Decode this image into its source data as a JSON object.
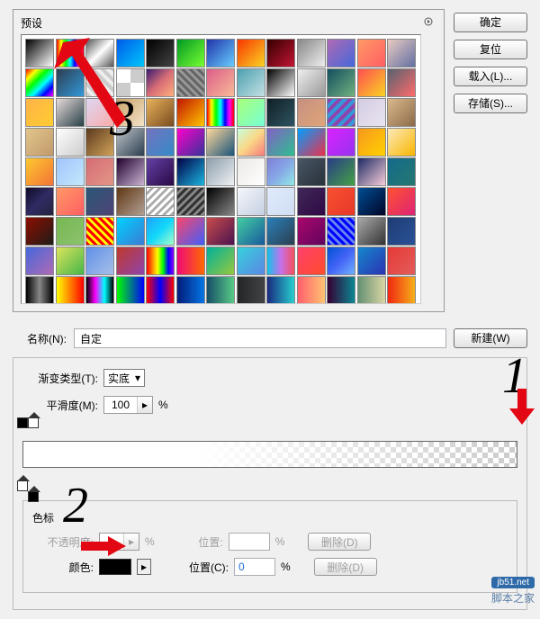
{
  "annotations": {
    "one": "1",
    "two": "2",
    "three": "3"
  },
  "presets": {
    "title": "预设"
  },
  "buttons": {
    "ok": "确定",
    "reset": "复位",
    "load": "载入(L)...",
    "save": "存储(S)...",
    "new": "新建(W)"
  },
  "name_row": {
    "label": "名称(N):",
    "value": "自定"
  },
  "gradient": {
    "type_label": "渐变类型(T):",
    "type_value": "实底",
    "smooth_label": "平滑度(M):",
    "smooth_value": "100",
    "percent": "%"
  },
  "stops": {
    "title": "色标",
    "opacity_label": "不透明度:",
    "position_label": "位置:",
    "percent": "%",
    "delete": "删除(D)",
    "color_label": "颜色:",
    "position2_label": "位置(C):",
    "position2_value": "0"
  },
  "watermark": {
    "badge": "jb51.net",
    "text": "脚本之家"
  },
  "swatches": [
    "linear-gradient(135deg,#000,#fff)",
    "linear-gradient(90deg,#f00,#ff0,#0f0,#0ff,#00f,#f0f,#f00)",
    "linear-gradient(135deg,#555,#fff,#555)",
    "linear-gradient(135deg,#005bea,#00c6fb)",
    "linear-gradient(135deg,#000,#434343)",
    "linear-gradient(135deg,#092,#7f3)",
    "linear-gradient(135deg,#23a,#6cf)",
    "linear-gradient(135deg,#f83600,#f9d423)",
    "linear-gradient(135deg,#300,#c31432)",
    "linear-gradient(135deg,#888,#eee)",
    "linear-gradient(135deg,#b06ab3,#4568dc)",
    "linear-gradient(135deg,#ff9966,#ff5e62)",
    "linear-gradient(135deg,#e8cbc0,#636fa4)",
    "linear-gradient(135deg,#f00,#ff0,#0f0,#0ff,#00f,#f0f)",
    "linear-gradient(135deg,#2c3e50,#3498db)",
    "repeating-linear-gradient(45deg,#ccc 0 4px,#eee 4px 8px)",
    "repeating-conic-gradient(#ccc 0 25%,#fff 0 50%)",
    "linear-gradient(135deg,#3a1c71,#d76d77,#ffaf7b)",
    "repeating-linear-gradient(45deg,#666 0 3px,#999 3px 6px)",
    "linear-gradient(135deg,#dd5e89,#f7bb97)",
    "linear-gradient(135deg,#4ca1af,#c4e0e5)",
    "linear-gradient(135deg,#000,#fff)",
    "linear-gradient(135deg,#eee,#999)",
    "linear-gradient(135deg,#134e5e,#71b280)",
    "linear-gradient(135deg,#ff4e50,#f9d423)",
    "linear-gradient(135deg,#556270,#ff6b6b)",
    "linear-gradient(135deg,#ffb347,#ffcc33)",
    "linear-gradient(135deg,#e6dada,#274046)",
    "linear-gradient(135deg,#ddd6f3,#faaca8)",
    "linear-gradient(135deg,#c9a36a,#f3e2c7)",
    "linear-gradient(135deg,#e8b25b,#7a4b1f)",
    "linear-gradient(135deg,#c21500,#ffc500)",
    "linear-gradient(90deg,#f00,#ff0,#0f0,#0ff,#00f,#f0f,#f00)",
    "linear-gradient(135deg,#a8ff78,#78ffd6)",
    "linear-gradient(135deg,#0f2027,#203a43,#2c5364)",
    "linear-gradient(135deg,#c79081,#dfa579)",
    "repeating-linear-gradient(135deg,#8e44ad 0 4px,#3498db 4px 8px)",
    "linear-gradient(135deg,#d3cce3,#e9e4f0)",
    "linear-gradient(135deg,#dab88b,#8b6b4a)",
    "linear-gradient(135deg,#e2c58b,#c19a6b)",
    "linear-gradient(135deg,#fff,#ccc)",
    "linear-gradient(135deg,#5b3a1e,#d2a35a)",
    "linear-gradient(135deg,#bdc3c7,#2c3e50)",
    "linear-gradient(135deg,#7474bf,#348ac7)",
    "linear-gradient(135deg,#ff00cc,#333399)",
    "linear-gradient(135deg,#ffd89b,#19547b)",
    "linear-gradient(135deg,#c6ffdd,#fbd786,#f7797d)",
    "linear-gradient(135deg,#8360c3,#2ebf91)",
    "linear-gradient(135deg,#009fff,#ec2f4b)",
    "linear-gradient(135deg,#da22ff,#9733ee)",
    "linear-gradient(135deg,#f7971e,#ffd200)",
    "linear-gradient(135deg,#fceabb,#f8b500)",
    "linear-gradient(135deg,#fdc830,#f37335)",
    "linear-gradient(135deg,#a1c4fd,#c2e9fb)",
    "linear-gradient(135deg,#d66d75,#e29587)",
    "linear-gradient(135deg,#20002c,#cbb4d4)",
    "linear-gradient(135deg,#6441a5,#2a0845)",
    "linear-gradient(135deg,#000046,#1cb5e0)",
    "linear-gradient(135deg,#8e9eab,#eef2f3)",
    "linear-gradient(135deg,#ece9e6,#fff)",
    "linear-gradient(135deg,#7f7fd5,#86a8e7,#91eae4)",
    "linear-gradient(135deg,#485563,#29323c)",
    "linear-gradient(135deg,#283c86,#45a247)",
    "linear-gradient(135deg,#1d2b64,#f8cdda)",
    "linear-gradient(135deg,#136a8a,#267871)",
    "linear-gradient(135deg,#0f0c29,#302b63,#24243e)",
    "linear-gradient(135deg,#ff9966,#ff5e62)",
    "linear-gradient(135deg,#2b5876,#4e4376)",
    "linear-gradient(135deg,#603813,#b29f94)",
    "repeating-linear-gradient(135deg,#fff 0 3px,#aaa 3px 6px)",
    "repeating-linear-gradient(135deg,#333 0 3px,#888 3px 6px)",
    "linear-gradient(135deg,#000,#888)",
    "linear-gradient(135deg,#f5f7fa,#c3cfe2)",
    "linear-gradient(135deg,#e0eafc,#cfdef3)",
    "linear-gradient(135deg,#41295a,#2f0743)",
    "linear-gradient(135deg,#f85032,#e73827)",
    "linear-gradient(135deg,#004e92,#000428)",
    "linear-gradient(135deg,#ff512f,#dd2476)",
    "linear-gradient(135deg,#8e0e00,#1f1c18)",
    "linear-gradient(135deg,#76b852,#8dc26f)",
    "repeating-linear-gradient(45deg,#f00 0 3px,#ff0 3px 6px)",
    "linear-gradient(135deg,#00d2ff,#3a7bd5)",
    "linear-gradient(135deg,#1fa2ff,#12d8fa,#a6ffcb)",
    "linear-gradient(135deg,#fc466b,#3f5efb)",
    "linear-gradient(135deg,#c94b4b,#4b134f)",
    "linear-gradient(135deg,#43cea2,#185a9d)",
    "linear-gradient(135deg,#2980b9,#2c3e50)",
    "linear-gradient(135deg,#aa076b,#61045f)",
    "repeating-linear-gradient(45deg,#00f 0 3px,#68e 3px 6px)",
    "linear-gradient(135deg,#aaa,#333)",
    "linear-gradient(135deg,#1e3c72,#2a5298)",
    "linear-gradient(135deg,#4568dc,#b06ab3)",
    "linear-gradient(135deg,#dce35b,#45b649)",
    "linear-gradient(135deg,#6190e8,#a7bfe8)",
    "linear-gradient(135deg,#c0392b,#8e44ad)",
    "linear-gradient(90deg,#ff0000,#ff7f00,#ffff00,#00ff00,#0000ff,#8b00ff)",
    "linear-gradient(90deg,#ee0979,#ff6a00)",
    "linear-gradient(135deg,#00b09b,#96c93d)",
    "linear-gradient(135deg,#36d1dc,#5b86e5)",
    "linear-gradient(90deg,#12c2e9,#c471ed,#f64f59)",
    "linear-gradient(135deg,#ff416c,#ff4b2b)",
    "linear-gradient(135deg,#0052d4,#4364f7,#6fb1fc)",
    "linear-gradient(135deg,#1488cc,#2b32b2)",
    "linear-gradient(135deg,#e53935,#e35d5b)",
    "linear-gradient(90deg,#000,#888,#000)",
    "linear-gradient(90deg,#ff0,#f00)",
    "linear-gradient(90deg,#000,#f0f,#0ff,#000)",
    "linear-gradient(90deg,#0f0,#00f)",
    "linear-gradient(90deg,#f00,#00f,#f00)",
    "linear-gradient(90deg,#021b79,#0575e6)",
    "linear-gradient(90deg,#184e68,#57ca85)",
    "linear-gradient(90deg,#232526,#414345)",
    "linear-gradient(90deg,#1a2980,#26d0ce)",
    "linear-gradient(90deg,#ff5f6d,#ffc371)",
    "linear-gradient(90deg,#360033,#0b8793)",
    "linear-gradient(90deg,#649173,#dbd5a4)",
    "linear-gradient(90deg,#f12711,#f5af19)"
  ]
}
